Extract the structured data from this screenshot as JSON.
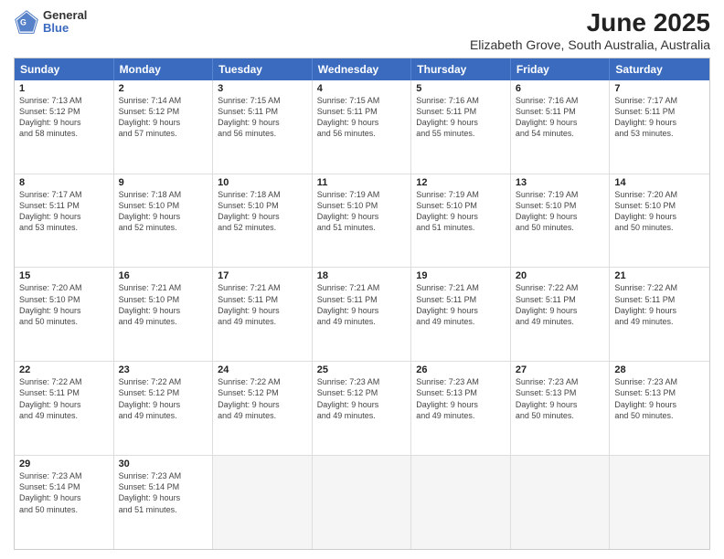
{
  "header": {
    "logo_general": "General",
    "logo_blue": "Blue",
    "title": "June 2025",
    "subtitle": "Elizabeth Grove, South Australia, Australia"
  },
  "calendar": {
    "days_of_week": [
      "Sunday",
      "Monday",
      "Tuesday",
      "Wednesday",
      "Thursday",
      "Friday",
      "Saturday"
    ],
    "weeks": [
      [
        {
          "num": "",
          "empty": true
        },
        {
          "num": "",
          "empty": true
        },
        {
          "num": "",
          "empty": true
        },
        {
          "num": "",
          "empty": true
        },
        {
          "num": "",
          "empty": true
        },
        {
          "num": "",
          "empty": true
        },
        {
          "num": "1",
          "sunrise": "Sunrise: 7:17 AM",
          "sunset": "Sunset: 5:11 PM",
          "daylight": "Daylight: 9 hours",
          "daylight2": "and 53 minutes."
        }
      ],
      [
        {
          "num": "1",
          "sunrise": "Sunrise: 7:13 AM",
          "sunset": "Sunset: 5:12 PM",
          "daylight": "Daylight: 9 hours",
          "daylight2": "and 58 minutes."
        },
        {
          "num": "2",
          "sunrise": "Sunrise: 7:14 AM",
          "sunset": "Sunset: 5:12 PM",
          "daylight": "Daylight: 9 hours",
          "daylight2": "and 57 minutes."
        },
        {
          "num": "3",
          "sunrise": "Sunrise: 7:15 AM",
          "sunset": "Sunset: 5:11 PM",
          "daylight": "Daylight: 9 hours",
          "daylight2": "and 56 minutes."
        },
        {
          "num": "4",
          "sunrise": "Sunrise: 7:15 AM",
          "sunset": "Sunset: 5:11 PM",
          "daylight": "Daylight: 9 hours",
          "daylight2": "and 56 minutes."
        },
        {
          "num": "5",
          "sunrise": "Sunrise: 7:16 AM",
          "sunset": "Sunset: 5:11 PM",
          "daylight": "Daylight: 9 hours",
          "daylight2": "and 55 minutes."
        },
        {
          "num": "6",
          "sunrise": "Sunrise: 7:16 AM",
          "sunset": "Sunset: 5:11 PM",
          "daylight": "Daylight: 9 hours",
          "daylight2": "and 54 minutes."
        },
        {
          "num": "7",
          "sunrise": "Sunrise: 7:17 AM",
          "sunset": "Sunset: 5:11 PM",
          "daylight": "Daylight: 9 hours",
          "daylight2": "and 53 minutes."
        }
      ],
      [
        {
          "num": "8",
          "sunrise": "Sunrise: 7:17 AM",
          "sunset": "Sunset: 5:11 PM",
          "daylight": "Daylight: 9 hours",
          "daylight2": "and 53 minutes."
        },
        {
          "num": "9",
          "sunrise": "Sunrise: 7:18 AM",
          "sunset": "Sunset: 5:10 PM",
          "daylight": "Daylight: 9 hours",
          "daylight2": "and 52 minutes."
        },
        {
          "num": "10",
          "sunrise": "Sunrise: 7:18 AM",
          "sunset": "Sunset: 5:10 PM",
          "daylight": "Daylight: 9 hours",
          "daylight2": "and 52 minutes."
        },
        {
          "num": "11",
          "sunrise": "Sunrise: 7:19 AM",
          "sunset": "Sunset: 5:10 PM",
          "daylight": "Daylight: 9 hours",
          "daylight2": "and 51 minutes."
        },
        {
          "num": "12",
          "sunrise": "Sunrise: 7:19 AM",
          "sunset": "Sunset: 5:10 PM",
          "daylight": "Daylight: 9 hours",
          "daylight2": "and 51 minutes."
        },
        {
          "num": "13",
          "sunrise": "Sunrise: 7:19 AM",
          "sunset": "Sunset: 5:10 PM",
          "daylight": "Daylight: 9 hours",
          "daylight2": "and 50 minutes."
        },
        {
          "num": "14",
          "sunrise": "Sunrise: 7:20 AM",
          "sunset": "Sunset: 5:10 PM",
          "daylight": "Daylight: 9 hours",
          "daylight2": "and 50 minutes."
        }
      ],
      [
        {
          "num": "15",
          "sunrise": "Sunrise: 7:20 AM",
          "sunset": "Sunset: 5:10 PM",
          "daylight": "Daylight: 9 hours",
          "daylight2": "and 50 minutes."
        },
        {
          "num": "16",
          "sunrise": "Sunrise: 7:21 AM",
          "sunset": "Sunset: 5:10 PM",
          "daylight": "Daylight: 9 hours",
          "daylight2": "and 49 minutes."
        },
        {
          "num": "17",
          "sunrise": "Sunrise: 7:21 AM",
          "sunset": "Sunset: 5:11 PM",
          "daylight": "Daylight: 9 hours",
          "daylight2": "and 49 minutes."
        },
        {
          "num": "18",
          "sunrise": "Sunrise: 7:21 AM",
          "sunset": "Sunset: 5:11 PM",
          "daylight": "Daylight: 9 hours",
          "daylight2": "and 49 minutes."
        },
        {
          "num": "19",
          "sunrise": "Sunrise: 7:21 AM",
          "sunset": "Sunset: 5:11 PM",
          "daylight": "Daylight: 9 hours",
          "daylight2": "and 49 minutes."
        },
        {
          "num": "20",
          "sunrise": "Sunrise: 7:22 AM",
          "sunset": "Sunset: 5:11 PM",
          "daylight": "Daylight: 9 hours",
          "daylight2": "and 49 minutes."
        },
        {
          "num": "21",
          "sunrise": "Sunrise: 7:22 AM",
          "sunset": "Sunset: 5:11 PM",
          "daylight": "Daylight: 9 hours",
          "daylight2": "and 49 minutes."
        }
      ],
      [
        {
          "num": "22",
          "sunrise": "Sunrise: 7:22 AM",
          "sunset": "Sunset: 5:11 PM",
          "daylight": "Daylight: 9 hours",
          "daylight2": "and 49 minutes."
        },
        {
          "num": "23",
          "sunrise": "Sunrise: 7:22 AM",
          "sunset": "Sunset: 5:12 PM",
          "daylight": "Daylight: 9 hours",
          "daylight2": "and 49 minutes."
        },
        {
          "num": "24",
          "sunrise": "Sunrise: 7:22 AM",
          "sunset": "Sunset: 5:12 PM",
          "daylight": "Daylight: 9 hours",
          "daylight2": "and 49 minutes."
        },
        {
          "num": "25",
          "sunrise": "Sunrise: 7:23 AM",
          "sunset": "Sunset: 5:12 PM",
          "daylight": "Daylight: 9 hours",
          "daylight2": "and 49 minutes."
        },
        {
          "num": "26",
          "sunrise": "Sunrise: 7:23 AM",
          "sunset": "Sunset: 5:13 PM",
          "daylight": "Daylight: 9 hours",
          "daylight2": "and 49 minutes."
        },
        {
          "num": "27",
          "sunrise": "Sunrise: 7:23 AM",
          "sunset": "Sunset: 5:13 PM",
          "daylight": "Daylight: 9 hours",
          "daylight2": "and 50 minutes."
        },
        {
          "num": "28",
          "sunrise": "Sunrise: 7:23 AM",
          "sunset": "Sunset: 5:13 PM",
          "daylight": "Daylight: 9 hours",
          "daylight2": "and 50 minutes."
        }
      ],
      [
        {
          "num": "29",
          "sunrise": "Sunrise: 7:23 AM",
          "sunset": "Sunset: 5:14 PM",
          "daylight": "Daylight: 9 hours",
          "daylight2": "and 50 minutes."
        },
        {
          "num": "30",
          "sunrise": "Sunrise: 7:23 AM",
          "sunset": "Sunset: 5:14 PM",
          "daylight": "Daylight: 9 hours",
          "daylight2": "and 51 minutes."
        },
        {
          "num": "",
          "empty": true
        },
        {
          "num": "",
          "empty": true
        },
        {
          "num": "",
          "empty": true
        },
        {
          "num": "",
          "empty": true
        },
        {
          "num": "",
          "empty": true
        }
      ]
    ]
  }
}
